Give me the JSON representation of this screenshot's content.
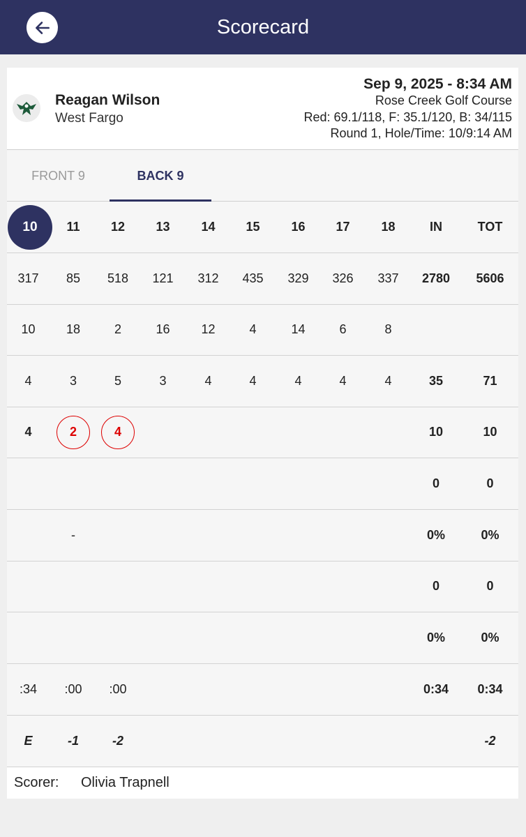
{
  "header": {
    "title": "Scorecard",
    "back_icon": "arrow-left-icon"
  },
  "player": {
    "name": "Reagan Wilson",
    "team": "West Fargo",
    "logo_icon": "team-logo-icon",
    "date": "Sep 9, 2025 - 8:34 AM",
    "course": "Rose Creek Golf Course",
    "tee_info": "Red: 69.1/118, F: 35.1/120, B: 34/115",
    "round_info": "Round 1, Hole/Time: 10/9:14 AM"
  },
  "tabs": {
    "front": "FRONT 9",
    "back": "BACK 9",
    "selected": "BACK 9"
  },
  "table": {
    "headers": [
      "10",
      "11",
      "12",
      "13",
      "14",
      "15",
      "16",
      "17",
      "18",
      "IN",
      "TOT"
    ],
    "current_hole": "10",
    "yardage": [
      "317",
      "85",
      "518",
      "121",
      "312",
      "435",
      "329",
      "326",
      "337",
      "2780",
      "5606"
    ],
    "handicap": [
      "10",
      "18",
      "2",
      "16",
      "12",
      "4",
      "14",
      "6",
      "8",
      "",
      ""
    ],
    "par": [
      "4",
      "3",
      "5",
      "3",
      "4",
      "4",
      "4",
      "4",
      "4",
      "35",
      "71"
    ],
    "score": [
      "4",
      "2",
      "4",
      "",
      "",
      "",
      "",
      "",
      "",
      "10",
      "10"
    ],
    "stat_a": [
      "",
      "",
      "",
      "",
      "",
      "",
      "",
      "",
      "",
      "0",
      "0"
    ],
    "stat_b": [
      "",
      "-",
      "",
      "",
      "",
      "",
      "",
      "",
      "",
      "0%",
      "0%"
    ],
    "stat_c": [
      "",
      "",
      "",
      "",
      "",
      "",
      "",
      "",
      "",
      "0",
      "0"
    ],
    "stat_d": [
      "",
      "",
      "",
      "",
      "",
      "",
      "",
      "",
      "",
      "0%",
      "0%"
    ],
    "time": [
      ":34",
      ":00",
      ":00",
      "",
      "",
      "",
      "",
      "",
      "",
      "0:34",
      "0:34"
    ],
    "to_par": [
      "E",
      "-1",
      "-2",
      "",
      "",
      "",
      "",
      "",
      "",
      "",
      "-2"
    ]
  },
  "scorer": {
    "label": "Scorer:",
    "name": "Olivia Trapnell"
  },
  "colors": {
    "primary": "#2e3261",
    "circle_red": "#dd0000",
    "background": "#efefef"
  }
}
